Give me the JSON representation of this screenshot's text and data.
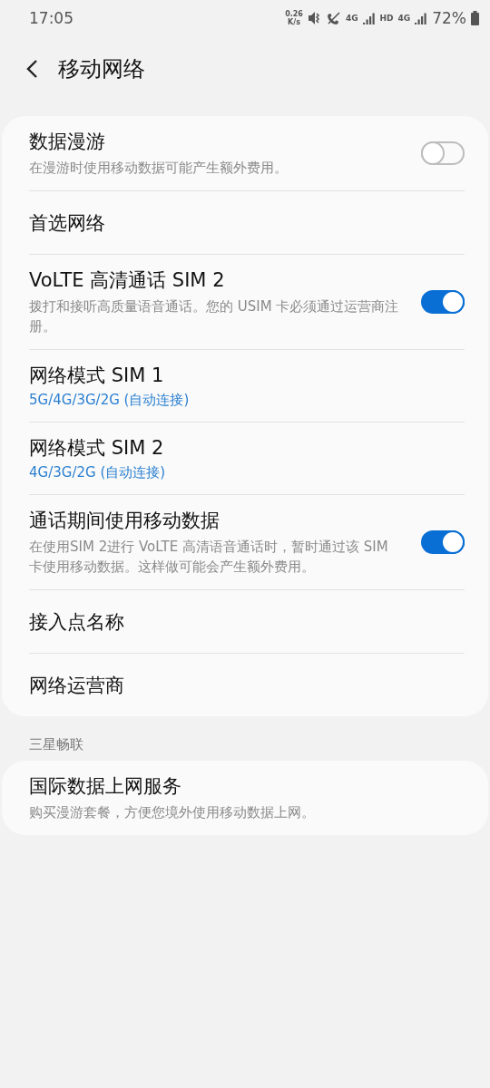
{
  "status_bar": {
    "time": "17:05",
    "speed": [
      "0.26",
      "K/s"
    ],
    "sim_labels": [
      "4G",
      "HD",
      "4G"
    ],
    "battery": "72%"
  },
  "header": {
    "title": "移动网络"
  },
  "sections": [
    {
      "items": [
        {
          "kind": "toggle",
          "title": "数据漫游",
          "summary": "在漫游时使用移动数据可能产生额外费用。",
          "on": false
        },
        {
          "kind": "link",
          "title": "首选网络"
        },
        {
          "kind": "toggle",
          "title": "VoLTE 高清通话 SIM 2",
          "summary": "拨打和接听高质量语音通话。您的 USIM 卡必须通过运营商注册。",
          "on": true
        },
        {
          "kind": "link",
          "title": "网络模式 SIM 1",
          "value": "5G/4G/3G/2G (自动连接)"
        },
        {
          "kind": "link",
          "title": "网络模式 SIM 2",
          "value": "4G/3G/2G (自动连接)"
        },
        {
          "kind": "toggle",
          "title": "通话期间使用移动数据",
          "summary": "在使用SIM 2进行 VoLTE 高清语音通话时，暂时通过该 SIM 卡使用移动数据。这样做可能会产生额外费用。",
          "on": true
        },
        {
          "kind": "link",
          "title": "接入点名称"
        },
        {
          "kind": "link",
          "title": "网络运营商"
        }
      ]
    },
    {
      "heading": "三星畅联",
      "items": [
        {
          "kind": "link",
          "title": "国际数据上网服务",
          "summary": "购买漫游套餐，方便您境外使用移动数据上网。"
        }
      ]
    }
  ]
}
